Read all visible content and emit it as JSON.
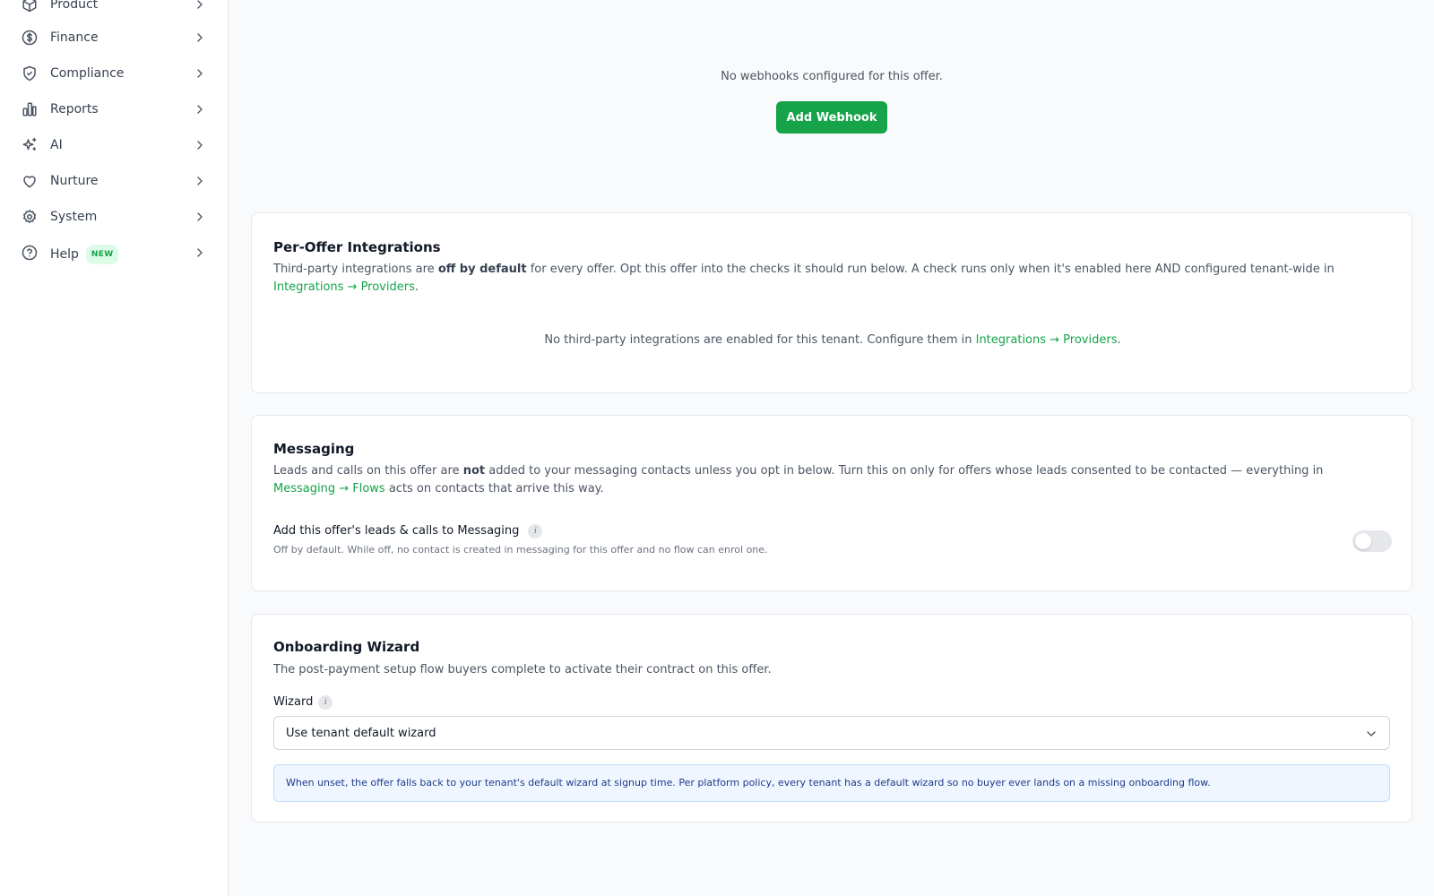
{
  "sidebar": {
    "items": [
      {
        "label": "Product",
        "icon": "cube-icon"
      },
      {
        "label": "Finance",
        "icon": "dollar-icon"
      },
      {
        "label": "Compliance",
        "icon": "shield-icon"
      },
      {
        "label": "Reports",
        "icon": "bar-chart-icon"
      },
      {
        "label": "AI",
        "icon": "sparkles-icon"
      },
      {
        "label": "Nurture",
        "icon": "heart-icon"
      },
      {
        "label": "System",
        "icon": "gear-icon"
      },
      {
        "label": "Help",
        "icon": "help-circle-icon",
        "badge": "NEW"
      }
    ]
  },
  "webhooks": {
    "empty_text": "No webhooks configured for this offer.",
    "add_button": "Add Webhook"
  },
  "integrations": {
    "title": "Per-Offer Integrations",
    "desc_1": "Third-party integrations are ",
    "desc_bold": "off by default",
    "desc_2": " for every offer. Opt this offer into the checks it should run below. A check runs only when it's enabled here AND configured tenant-wide in ",
    "desc_link": "Integrations → Providers",
    "desc_3": ".",
    "empty_1": "No third-party integrations are enabled for this tenant. Configure them in ",
    "empty_link": "Integrations → Providers",
    "empty_2": "."
  },
  "messaging": {
    "title": "Messaging",
    "desc_1": "Leads and calls on this offer are ",
    "desc_bold": "not",
    "desc_2": " added to your messaging contacts unless you opt in below. Turn this on only for offers whose leads consented to be contacted — everything in ",
    "desc_link": "Messaging → Flows",
    "desc_3": " acts on contacts that arrive this way.",
    "toggle_label": "Add this offer's leads & calls to Messaging",
    "info_glyph": "i",
    "toggle_sub": "Off by default. While off, no contact is created in messaging for this offer and no flow can enrol one.",
    "toggle_on": false
  },
  "onboarding": {
    "title": "Onboarding Wizard",
    "desc": "The post-payment setup flow buyers complete to activate their contract on this offer.",
    "field_label": "Wizard",
    "info_glyph": "i",
    "select_value": "Use tenant default wizard",
    "info_text": "When unset, the offer falls back to your tenant's default wizard at signup time. Per platform policy, every tenant has a default wizard so no buyer ever lands on a missing onboarding flow."
  },
  "colors": {
    "accent": "#16a34a",
    "info_bg": "#eff6ff",
    "info_text": "#1e3a8a"
  }
}
